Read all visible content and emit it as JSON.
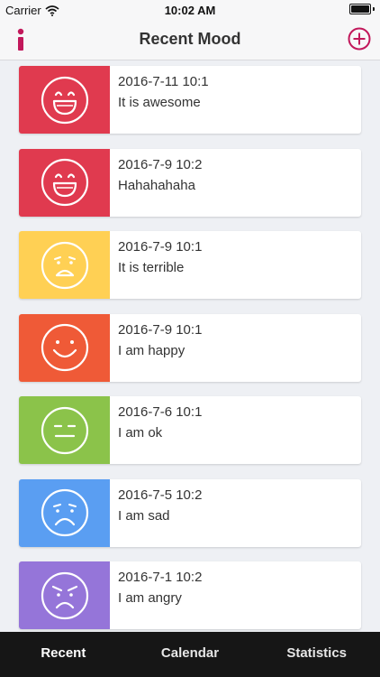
{
  "status_bar": {
    "carrier": "Carrier",
    "time": "10:02 AM"
  },
  "nav": {
    "title": "Recent Mood",
    "accent_color": "#c2185b"
  },
  "entries": [
    {
      "date": "2016-7-11 10:1",
      "text": "It is awesome",
      "color": "#e03a4f",
      "mood": "laughing"
    },
    {
      "date": "2016-7-9 10:2",
      "text": "Hahahahaha",
      "color": "#e03a4f",
      "mood": "laughing"
    },
    {
      "date": "2016-7-9 10:1",
      "text": "It is terrible",
      "color": "#ffd054",
      "mood": "worried"
    },
    {
      "date": "2016-7-9 10:1",
      "text": "I am happy",
      "color": "#ef5a37",
      "mood": "smile"
    },
    {
      "date": "2016-7-6 10:1",
      "text": "I am ok",
      "color": "#8bc34a",
      "mood": "neutral"
    },
    {
      "date": "2016-7-5 10:2",
      "text": "I am sad",
      "color": "#5a9ef2",
      "mood": "sad"
    },
    {
      "date": "2016-7-1 10:2",
      "text": "I am angry",
      "color": "#9575d9",
      "mood": "angry"
    }
  ],
  "tabs": [
    {
      "label": "Recent",
      "active": true
    },
    {
      "label": "Calendar",
      "active": false
    },
    {
      "label": "Statistics",
      "active": false
    }
  ]
}
